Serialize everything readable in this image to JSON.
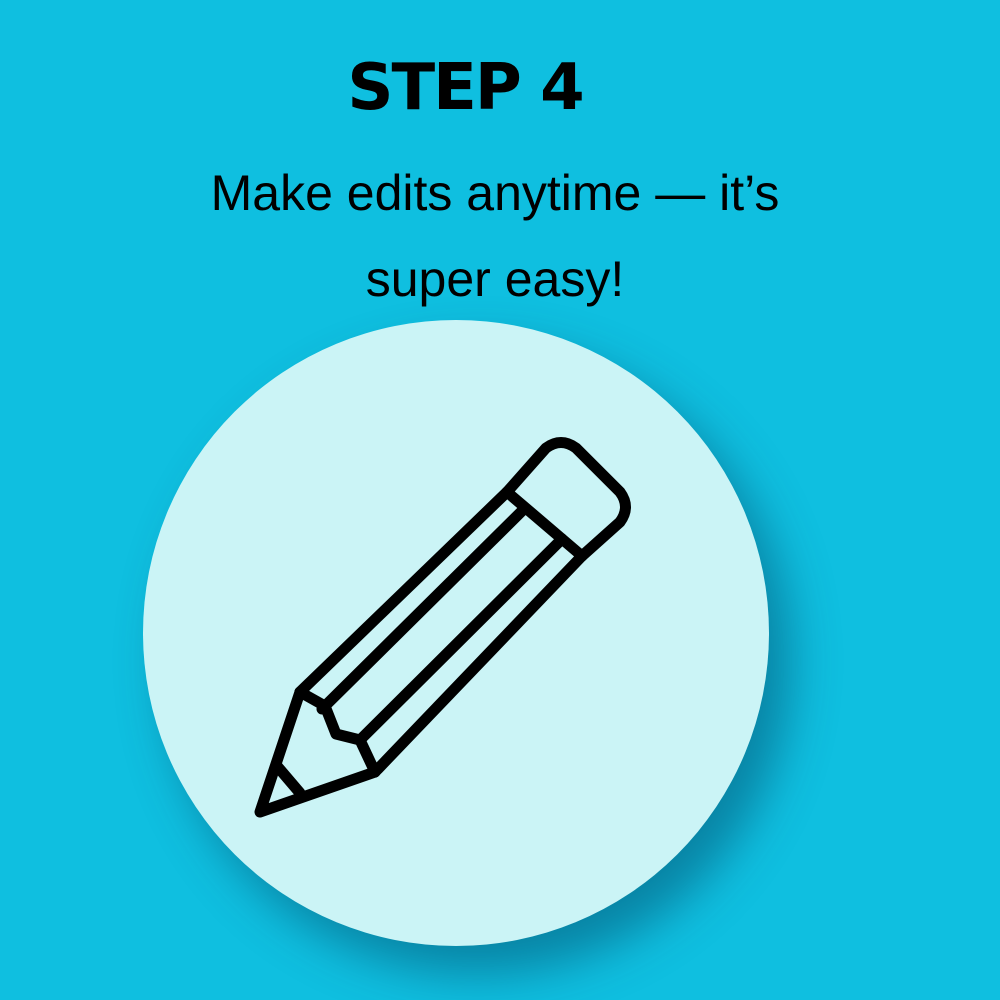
{
  "step": {
    "title": "STEP 4",
    "line1": "Make edits anytime — it’s",
    "line2": "super easy!"
  },
  "colors": {
    "background": "#0fbfe0",
    "circle": "#cbf4f6",
    "ink": "#000000"
  },
  "icon": {
    "name": "pencil-icon"
  }
}
